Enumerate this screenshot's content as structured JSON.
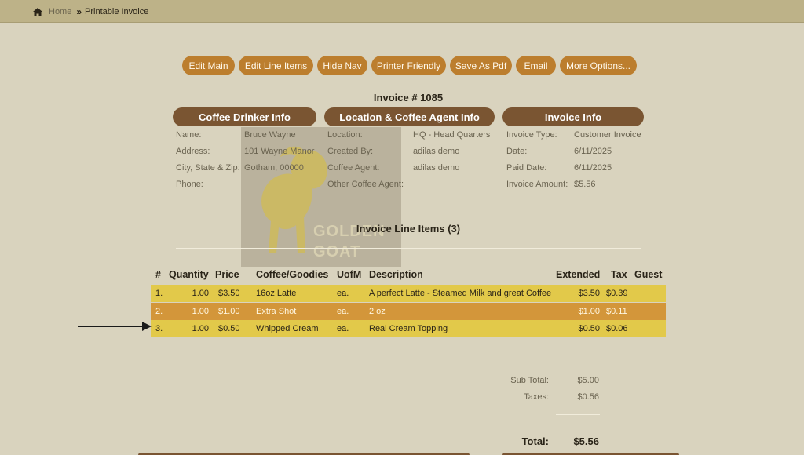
{
  "breadcrumb": {
    "home": "Home",
    "current": "Printable Invoice"
  },
  "buttons": [
    "Edit Main",
    "Edit Line Items",
    "Hide Nav",
    "Printer Friendly",
    "Save As Pdf",
    "Email",
    "More Options..."
  ],
  "invoice_title": "Invoice # 1085",
  "sections": {
    "drinker": {
      "title": "Coffee Drinker Info",
      "labels": [
        "Name:",
        "Address:",
        "City, State & Zip:",
        "Phone:"
      ],
      "values": [
        "Bruce Wayne",
        "101 Wayne Manor",
        "Gotham, 00000",
        ""
      ]
    },
    "location": {
      "title": "Location & Coffee Agent Info",
      "labels": [
        "Location:",
        "Created By:",
        "Coffee Agent:",
        "Other Coffee Agent:"
      ],
      "values": [
        "HQ - Head Quarters",
        "adilas demo",
        "adilas demo",
        ""
      ]
    },
    "invoice": {
      "title": "Invoice Info",
      "labels": [
        "Invoice Type:",
        "Date:",
        "Paid Date:",
        "Invoice Amount:"
      ],
      "values": [
        "Customer Invoice",
        "6/11/2025",
        "6/11/2025",
        "$5.56"
      ]
    }
  },
  "watermark": {
    "line1": "GOLDEN",
    "line2": "GOAT"
  },
  "line_items_title": "Invoice Line Items (3)",
  "table": {
    "headers": [
      "#",
      "Quantity",
      "Price",
      "Coffee/Goodies",
      "UofM",
      "Description",
      "Extended",
      "Tax",
      "Guest"
    ],
    "rows": [
      [
        "1.",
        "1.00",
        "$3.50",
        "16oz Latte",
        "ea.",
        "A perfect Latte - Steamed Milk and great Coffee",
        "$3.50",
        "$0.39",
        ""
      ],
      [
        "2.",
        "1.00",
        "$1.00",
        "Extra Shot",
        "ea.",
        "2 oz",
        "$1.00",
        "$0.11",
        ""
      ],
      [
        "3.",
        "1.00",
        "$0.50",
        "Whipped Cream",
        "ea.",
        "Real Cream Topping",
        "$0.50",
        "$0.06",
        ""
      ]
    ]
  },
  "totals": {
    "subtotal_label": "Sub Total:",
    "subtotal": "$5.00",
    "taxes_label": "Taxes:",
    "taxes": "$0.56",
    "total_label": "Total:",
    "total": "$5.56"
  },
  "colors": {
    "row_yellow": "#e2c94a",
    "row_orange": "#d3963a",
    "button": "#bc7e2e",
    "pill": "#7a5532"
  }
}
